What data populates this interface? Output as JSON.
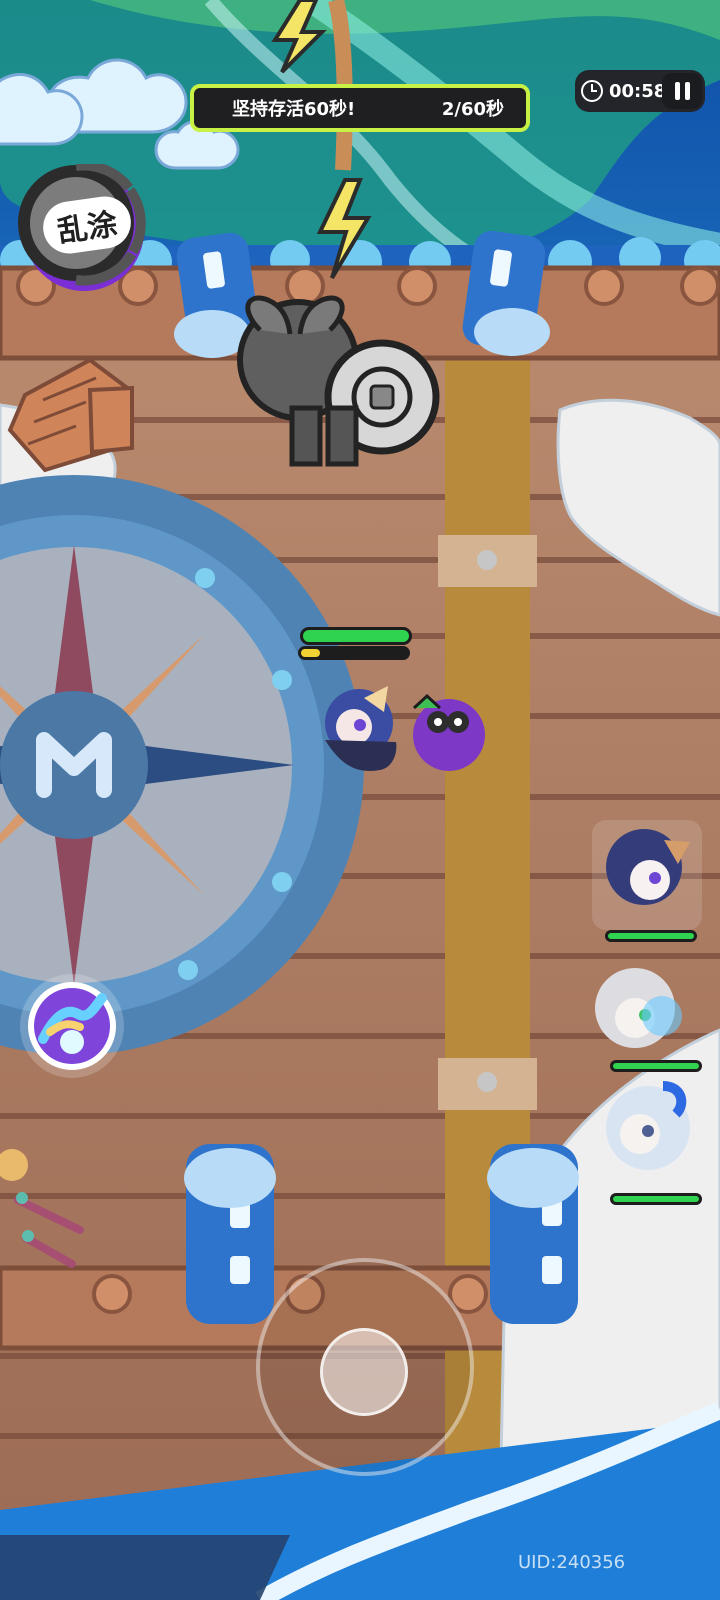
{
  "hud": {
    "objective_text": "坚持存活60秒!",
    "objective_progress": "2/60秒",
    "timer": "00:58",
    "pause_icon": "pause-icon",
    "skill_label": "乱涂",
    "uid": "UID:240356"
  },
  "player": {
    "health_fraction": 1.0,
    "energy_fraction": 0.18
  },
  "party": [
    {
      "health_fraction": 1.0
    },
    {
      "health_fraction": 1.0
    },
    {
      "health_fraction": 1.0
    }
  ],
  "colors": {
    "accent_green": "#c8f146",
    "health_green": "#2fd34f",
    "energy_yellow": "#f1d334",
    "skill_purple": "#7a2ed4",
    "ocean_blue": "#2f78c8",
    "deck_brown": "#a36f54"
  }
}
